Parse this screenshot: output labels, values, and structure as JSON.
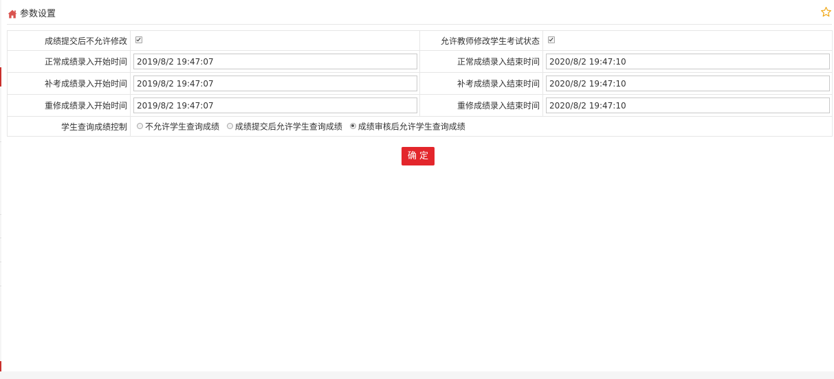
{
  "header": {
    "title": "参数设置",
    "home_icon": "home-icon",
    "favorite_icon": "star-icon"
  },
  "form": {
    "no_modify_after_submit": {
      "label": "成绩提交后不允许修改",
      "checked": true
    },
    "teacher_modify_exam_status": {
      "label": "允许教师修改学生考试状态",
      "checked": true
    },
    "normal_start": {
      "label": "正常成绩录入开始时间",
      "value": "2019/8/2 19:47:07"
    },
    "normal_end": {
      "label": "正常成绩录入结束时间",
      "value": "2020/8/2 19:47:10"
    },
    "makeup_start": {
      "label": "补考成绩录入开始时间",
      "value": "2019/8/2 19:47:07"
    },
    "makeup_end": {
      "label": "补考成绩录入结束时间",
      "value": "2020/8/2 19:47:10"
    },
    "retake_start": {
      "label": "重修成绩录入开始时间",
      "value": "2019/8/2 19:47:07"
    },
    "retake_end": {
      "label": "重修成绩录入结束时间",
      "value": "2020/8/2 19:47:10"
    },
    "query_control": {
      "label": "学生查询成绩控制",
      "options": [
        "不允许学生查询成绩",
        "成绩提交后允许学生查询成绩",
        "成绩审核后允许学生查询成绩"
      ],
      "selected": "成绩审核后允许学生查询成绩"
    }
  },
  "actions": {
    "confirm_label": "确 定"
  },
  "colors": {
    "accent": "#e3262c",
    "border": "#e6e6e6",
    "star": "#f0a30a",
    "home": "#d9534f"
  }
}
